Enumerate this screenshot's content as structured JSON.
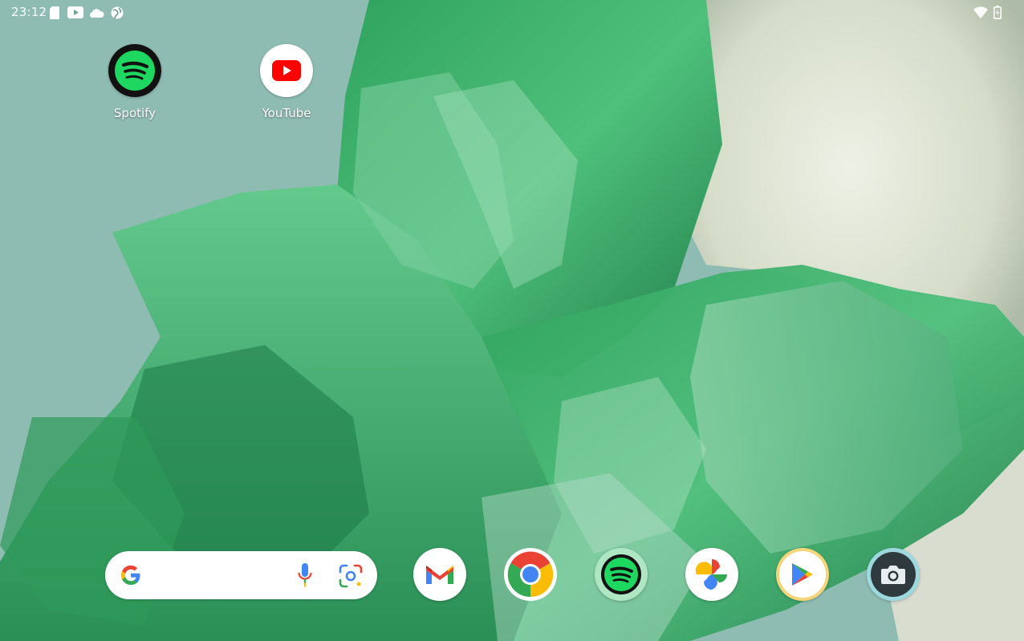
{
  "status_bar": {
    "time": "23:12",
    "left_icons": [
      "sd-card-icon",
      "youtube-notification-icon",
      "cloud-icon",
      "globe-icon"
    ],
    "right_icons": [
      "wifi-icon",
      "battery-charging-icon"
    ]
  },
  "home_apps": [
    {
      "name": "spotify",
      "label": "Spotify",
      "icon": "spotify-icon"
    },
    {
      "name": "youtube",
      "label": "YouTube",
      "icon": "youtube-icon"
    }
  ],
  "search_bar": {
    "icons": [
      "google-g-icon",
      "microphone-icon",
      "google-lens-icon"
    ]
  },
  "dock": [
    {
      "name": "gmail",
      "icon": "gmail-icon"
    },
    {
      "name": "chrome",
      "icon": "chrome-icon"
    },
    {
      "name": "spotify",
      "icon": "spotify-icon"
    },
    {
      "name": "photos",
      "icon": "google-photos-icon"
    },
    {
      "name": "play-store",
      "icon": "play-store-icon"
    },
    {
      "name": "camera",
      "icon": "camera-icon"
    }
  ],
  "colors": {
    "spotify_green": "#1ed760",
    "youtube_red": "#ff0000",
    "wallpaper_teal": "#8fbcb2",
    "crystal_green": "#3fae6a"
  }
}
